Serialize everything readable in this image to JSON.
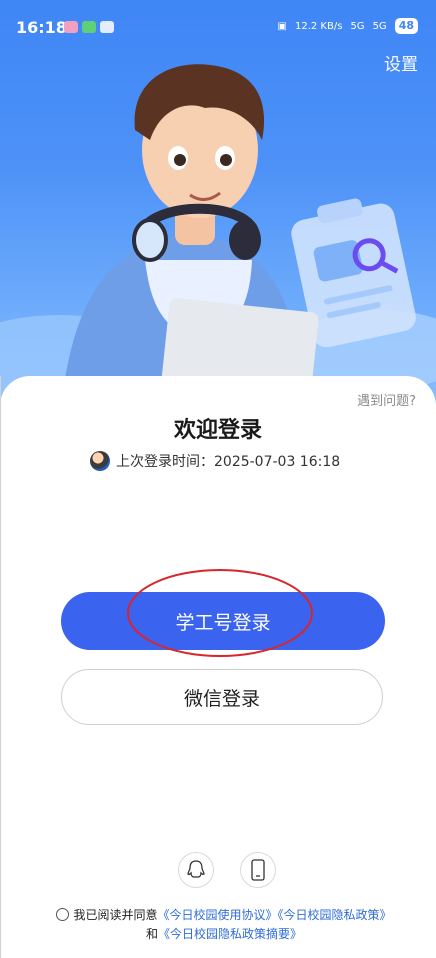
{
  "status_bar": {
    "time": "16:18",
    "speed": "12.2 KB/s",
    "network1": "5G",
    "network2": "5G",
    "battery": "48"
  },
  "header": {
    "settings_label": "设置"
  },
  "card": {
    "help_label": "遇到问题?",
    "welcome_title": "欢迎登录",
    "last_login_text": "上次登录时间：2025-07-03 16:18"
  },
  "buttons": {
    "primary_label": "学工号登录",
    "secondary_label": "微信登录"
  },
  "alt_login": {
    "icons": [
      "qq-icon",
      "phone-icon"
    ]
  },
  "agreement": {
    "prefix": "我已阅读并同意",
    "link1": "《今日校园使用协议》",
    "link2": "《今日校园隐私政策》",
    "and": "和",
    "link3": "《今日校园隐私政策摘要》"
  },
  "colors": {
    "primary": "#3a64f0",
    "hero_blue": "#3f86f6",
    "annotation_red": "#d9262c",
    "link": "#2f6bd8"
  }
}
